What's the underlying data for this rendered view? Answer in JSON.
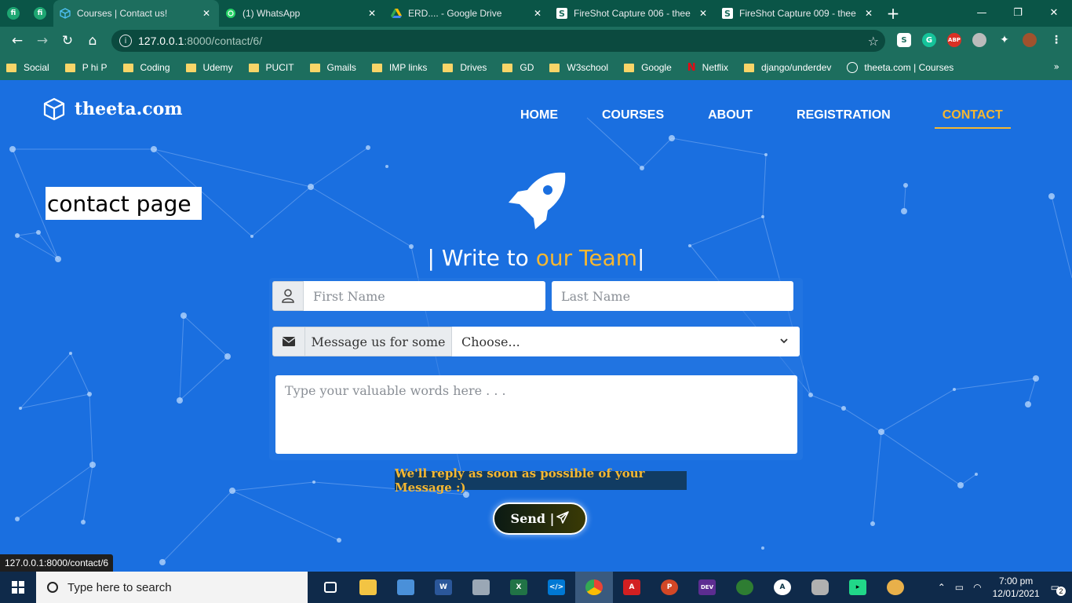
{
  "browser": {
    "tabs": [
      {
        "title": "Courses | Contact us!",
        "active": true
      },
      {
        "title": "(1) WhatsApp",
        "active": false
      },
      {
        "title": "ERD.... - Google Drive",
        "active": false
      },
      {
        "title": "FireShot Capture 006 - thee",
        "active": false
      },
      {
        "title": "FireShot Capture 009 - thee",
        "active": false
      }
    ],
    "pinned_tabs": [
      "fi",
      "fi"
    ],
    "url_host": "127.0.0.1",
    "url_path": ":8000/contact/6/",
    "bookmarks": [
      "Social",
      "P hi P",
      "Coding",
      "Udemy",
      "PUCIT",
      "Gmails",
      "IMP links",
      "Drives",
      "GD",
      "W3school",
      "Google",
      "Netflix",
      "django/underdev",
      "theeta.com | Courses"
    ],
    "status_url": "127.0.0.1:8000/contact/6"
  },
  "site": {
    "logo": "theeta.com",
    "nav": [
      "HOME",
      "COURSES",
      "ABOUT",
      "REGISTRATION",
      "CONTACT"
    ],
    "active_nav": "CONTACT",
    "page_label": "contact page",
    "heading_prefix": "| Write to ",
    "heading_accent": "our Team",
    "heading_suffix": "|",
    "form": {
      "first_name_placeholder": "First Name",
      "last_name_placeholder": "Last Name",
      "message_label": "Message us for some",
      "select_value": "Choose...",
      "textarea_placeholder": "Type your valuable words here . . .",
      "reply_note": "We'll reply as soon as possible of your Message :)",
      "send_label": "Send |"
    },
    "colors": {
      "background": "#1a6fe0",
      "accent": "#f5b731"
    }
  },
  "taskbar": {
    "search_placeholder": "Type here to search",
    "time": "7:00 pm",
    "date": "12/01/2021",
    "notifications": "2"
  }
}
